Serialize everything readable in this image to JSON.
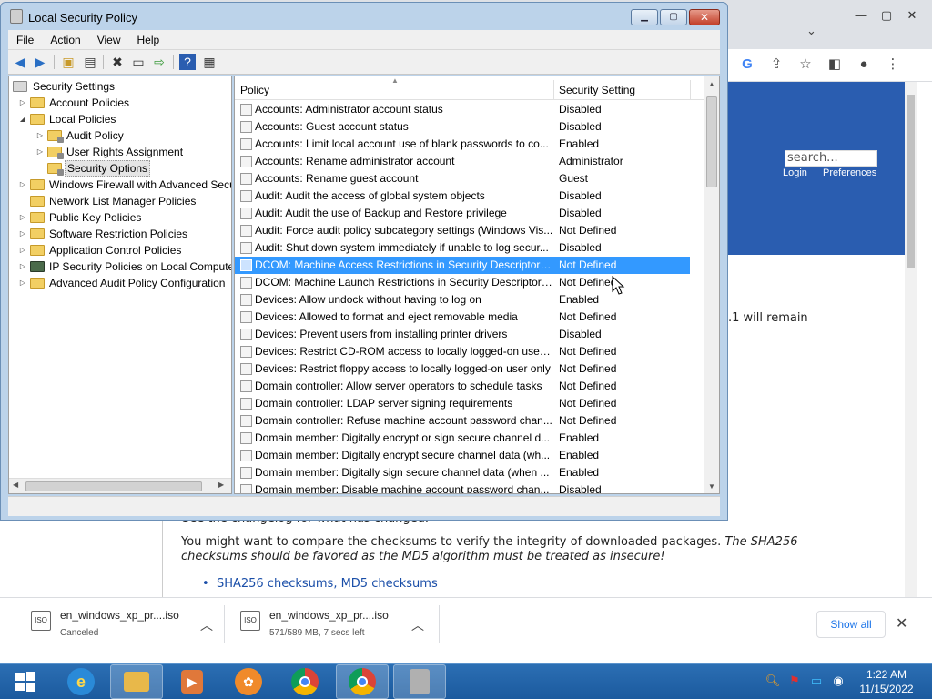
{
  "browser": {
    "search_placeholder": "search...",
    "login_link": "Login",
    "preferences_link": "Preferences",
    "remain_text": ".1 will remain",
    "cut_text": "See the changelog for what has changed.",
    "paragraph_plain": "You might want to compare the checksums to verify the integrity of downloaded packages. ",
    "paragraph_italic": "The SHA256 checksums should be favored as the MD5 algorithm must be treated as insecure!",
    "bullet_link": "SHA256 checksums, MD5 checksums"
  },
  "downloads": {
    "items": [
      {
        "name": "en_windows_xp_pr....iso",
        "status": "Canceled"
      },
      {
        "name": "en_windows_xp_pr....iso",
        "status": "571/589 MB, 7 secs left"
      }
    ],
    "show_all_label": "Show all"
  },
  "window": {
    "title": "Local Security Policy",
    "menu": [
      "File",
      "Action",
      "View",
      "Help"
    ]
  },
  "tree": {
    "items": [
      {
        "label": "Security Settings",
        "expander": "",
        "icon": "root"
      },
      {
        "label": "Account Policies",
        "expander": "▷",
        "icon": "folder"
      },
      {
        "label": "Local Policies",
        "expander": "◢",
        "icon": "folder"
      },
      {
        "label": "Audit Policy",
        "expander": "▷",
        "icon": "folder-lock"
      },
      {
        "label": "User Rights Assignment",
        "expander": "▷",
        "icon": "folder-lock"
      },
      {
        "label": "Security Options",
        "expander": "",
        "icon": "folder-lock",
        "selected": true
      },
      {
        "label": "Windows Firewall with Advanced Security",
        "expander": "▷",
        "icon": "folder"
      },
      {
        "label": "Network List Manager Policies",
        "expander": "",
        "icon": "folder"
      },
      {
        "label": "Public Key Policies",
        "expander": "▷",
        "icon": "folder"
      },
      {
        "label": "Software Restriction Policies",
        "expander": "▷",
        "icon": "folder"
      },
      {
        "label": "Application Control Policies",
        "expander": "▷",
        "icon": "folder"
      },
      {
        "label": "IP Security Policies on Local Computer",
        "expander": "▷",
        "icon": "ipsec"
      },
      {
        "label": "Advanced Audit Policy Configuration",
        "expander": "▷",
        "icon": "folder"
      }
    ]
  },
  "list": {
    "col_policy": "Policy",
    "col_setting": "Security Setting",
    "rows": [
      {
        "policy": "Accounts: Administrator account status",
        "setting": "Disabled"
      },
      {
        "policy": "Accounts: Guest account status",
        "setting": "Disabled"
      },
      {
        "policy": "Accounts: Limit local account use of blank passwords to co...",
        "setting": "Enabled"
      },
      {
        "policy": "Accounts: Rename administrator account",
        "setting": "Administrator"
      },
      {
        "policy": "Accounts: Rename guest account",
        "setting": "Guest"
      },
      {
        "policy": "Audit: Audit the access of global system objects",
        "setting": "Disabled"
      },
      {
        "policy": "Audit: Audit the use of Backup and Restore privilege",
        "setting": "Disabled"
      },
      {
        "policy": "Audit: Force audit policy subcategory settings (Windows Vis...",
        "setting": "Not Defined"
      },
      {
        "policy": "Audit: Shut down system immediately if unable to log secur...",
        "setting": "Disabled"
      },
      {
        "policy": "DCOM: Machine Access Restrictions in Security Descriptor D...",
        "setting": "Not Defined",
        "selected": true
      },
      {
        "policy": "DCOM: Machine Launch Restrictions in Security Descriptor ...",
        "setting": "Not Defined"
      },
      {
        "policy": "Devices: Allow undock without having to log on",
        "setting": "Enabled"
      },
      {
        "policy": "Devices: Allowed to format and eject removable media",
        "setting": "Not Defined"
      },
      {
        "policy": "Devices: Prevent users from installing printer drivers",
        "setting": "Disabled"
      },
      {
        "policy": "Devices: Restrict CD-ROM access to locally logged-on user ...",
        "setting": "Not Defined"
      },
      {
        "policy": "Devices: Restrict floppy access to locally logged-on user only",
        "setting": "Not Defined"
      },
      {
        "policy": "Domain controller: Allow server operators to schedule tasks",
        "setting": "Not Defined"
      },
      {
        "policy": "Domain controller: LDAP server signing requirements",
        "setting": "Not Defined"
      },
      {
        "policy": "Domain controller: Refuse machine account password chan...",
        "setting": "Not Defined"
      },
      {
        "policy": "Domain member: Digitally encrypt or sign secure channel d...",
        "setting": "Enabled"
      },
      {
        "policy": "Domain member: Digitally encrypt secure channel data (wh...",
        "setting": "Enabled"
      },
      {
        "policy": "Domain member: Digitally sign secure channel data (when ...",
        "setting": "Enabled"
      },
      {
        "policy": "Domain member: Disable machine account password chan...",
        "setting": "Disabled"
      }
    ]
  },
  "taskbar": {
    "time": "1:22 AM",
    "date": "11/15/2022"
  },
  "colors": {
    "selection": "#3399ff",
    "taskbar": "#1b5a9e",
    "link": "#1a4ea8"
  }
}
